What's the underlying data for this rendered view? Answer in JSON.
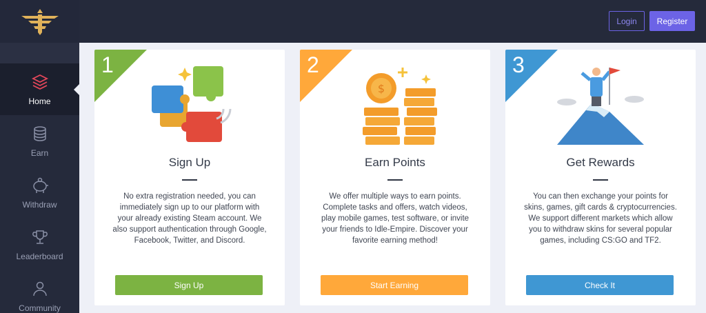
{
  "header": {
    "login_label": "Login",
    "register_label": "Register"
  },
  "sidebar": {
    "items": [
      {
        "label": "Home",
        "icon": "layers-icon",
        "active": true
      },
      {
        "label": "Earn",
        "icon": "coins-icon",
        "active": false
      },
      {
        "label": "Withdraw",
        "icon": "piggy-bank-icon",
        "active": false
      },
      {
        "label": "Leaderboard",
        "icon": "trophy-icon",
        "active": false
      },
      {
        "label": "Community",
        "icon": "users-icon",
        "active": false
      }
    ]
  },
  "steps": [
    {
      "number": "1",
      "title": "Sign Up",
      "text": "No extra registration needed, you can immediately sign up to our platform with your already existing Steam account. We also support authentication through Google, Facebook, Twitter, and Discord.",
      "button": "Sign Up",
      "color": "#7cb342",
      "illustration": "puzzle-icon"
    },
    {
      "number": "2",
      "title": "Earn Points",
      "text": "We offer multiple ways to earn points. Complete tasks and offers, watch videos, play mobile games, test software, or invite your friends to Idle-Empire. Discover your favorite earning method!",
      "button": "Start Earning",
      "color": "#ffa83a",
      "illustration": "coin-stack-icon"
    },
    {
      "number": "3",
      "title": "Get Rewards",
      "text": "You can then exchange your points for skins, games, gift cards & cryptocurrencies. We support different markets which allow you to withdraw skins for several popular games, including CS:GO and TF2.",
      "button": "Check It",
      "color": "#3f97d3",
      "illustration": "mountain-flag-icon"
    }
  ]
}
